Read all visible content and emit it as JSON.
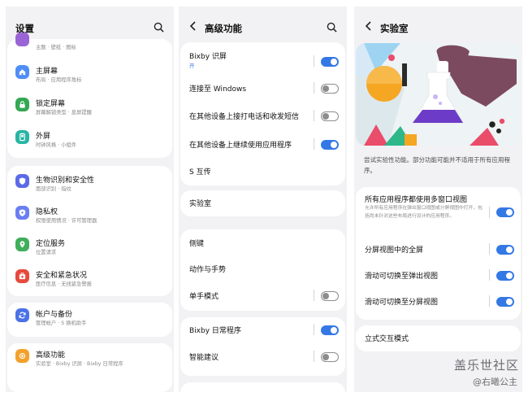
{
  "settings": {
    "title": "设置",
    "partial_sub": "主题 · 壁纸 · 图标",
    "items": [
      {
        "label": "主屏幕",
        "sub": "布局 · 应用程序角标",
        "icon": "home-icon",
        "color": "#4e8ef7"
      },
      {
        "label": "锁定屏幕",
        "sub": "屏幕解锁类型 · 息屏提醒",
        "icon": "lock-icon",
        "color": "#34a853"
      },
      {
        "label": "外屏",
        "sub": "时钟风格 · 小组件",
        "icon": "cover-screen-icon",
        "color": "#28b5a4"
      },
      {
        "label": "生物识别和安全性",
        "sub": "面部识别 · 指纹",
        "icon": "shield-icon",
        "color": "#5b6ae8"
      },
      {
        "label": "隐私权",
        "sub": "权限使用情况 · 许可管理器",
        "icon": "privacy-icon",
        "color": "#6a7ef2"
      },
      {
        "label": "定位服务",
        "sub": "位置请求",
        "icon": "location-icon",
        "color": "#3fae5a"
      },
      {
        "label": "安全和紧急状况",
        "sub": "医疗信息 · 无线紧急警报",
        "icon": "emergency-icon",
        "color": "#e64a3c"
      },
      {
        "label": "帐户与备份",
        "sub": "管理帐户 · S 换机助手",
        "icon": "sync-icon",
        "color": "#4b72e8"
      },
      {
        "label": "高级功能",
        "sub": "实验室 · Bixby 识屏 · Bixby 日常程序",
        "icon": "gear-plus-icon",
        "color": "#f3a12b"
      }
    ]
  },
  "advanced": {
    "title": "高级功能",
    "items": {
      "bixby_vision": {
        "label": "Bixby 识屏",
        "sub": "开",
        "toggle": "on"
      },
      "windows": {
        "label": "连接至 Windows",
        "toggle": "off"
      },
      "calls_sms": {
        "label": "在其他设备上接打电话和收发短信",
        "toggle": "off"
      },
      "continue_apps": {
        "label": "在其他设备上继续使用应用程序",
        "toggle": "on"
      },
      "s_share": {
        "label": "S 互传"
      },
      "labs": {
        "label": "实验室"
      },
      "side_key": {
        "label": "侧键"
      },
      "motions": {
        "label": "动作与手势"
      },
      "one_hand": {
        "label": "单手模式",
        "toggle": "off"
      },
      "routines": {
        "label": "Bixby 日常程序",
        "toggle": "on"
      },
      "suggestions": {
        "label": "智能建议",
        "toggle": "off"
      }
    }
  },
  "labs": {
    "title": "实验室",
    "description": "尝试实验性功能。部分功能可能并不适用于所有应用程序。",
    "items": {
      "multiwindow": {
        "label": "所有应用程序都使用多窗口视图",
        "sub": "允许所有应用程序在弹出窗口视图或分屏视图中打开，包括尚未针对这些布局进行设计的应用程序。",
        "toggle": "on"
      },
      "fullscreen_split": {
        "label": "分屏视图中的全屏",
        "toggle": "on"
      },
      "swipe_popup": {
        "label": "滑动可切换至弹出视图",
        "toggle": "on"
      },
      "swipe_split": {
        "label": "滑动可切换至分屏视图",
        "toggle": "on"
      },
      "flex_mode": {
        "label": "立式交互模式"
      }
    }
  },
  "watermark": {
    "brand": "盖乐世社区",
    "user": "@右曦公主"
  }
}
